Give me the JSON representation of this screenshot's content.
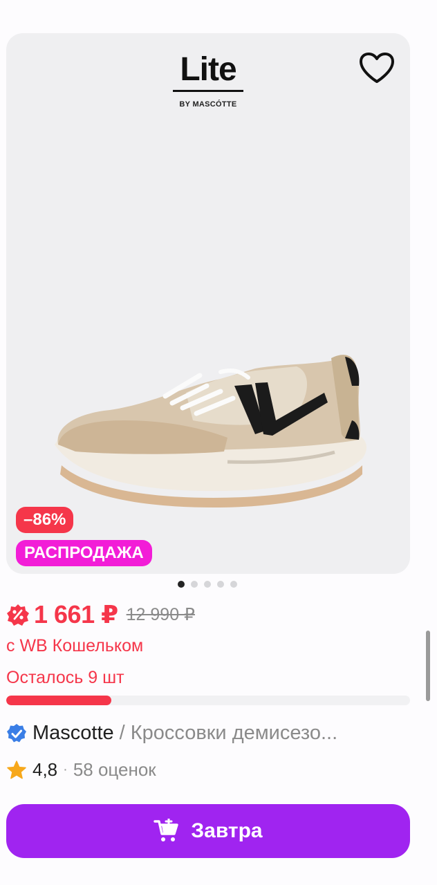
{
  "product_image": {
    "brand_logo": {
      "wordmark": "Lite",
      "subtext": "BY MASCÓTTE"
    },
    "favorite_icon": "heart-outline-icon",
    "discount_badge": "–86%",
    "sale_badge": "РАСПРОДАЖА",
    "carousel": {
      "count": 5,
      "active": 0
    }
  },
  "price": {
    "current": "1 661 ₽",
    "old": "12 990 ₽",
    "wallet_note": "с WB Кошельком"
  },
  "stock": {
    "label": "Осталось 9 шт",
    "level": 0.26
  },
  "product": {
    "brand": "Mascotte",
    "separator": "/",
    "title": "Кроссовки демисезо..."
  },
  "rating": {
    "value": "4,8",
    "dot": "·",
    "count": "58 оценок"
  },
  "buy_button": {
    "label": "Завтра",
    "icon": "cart-icon"
  },
  "colors": {
    "accent": "#a024f0",
    "price": "#f5364a",
    "sale_badge": "#f21dd7"
  }
}
